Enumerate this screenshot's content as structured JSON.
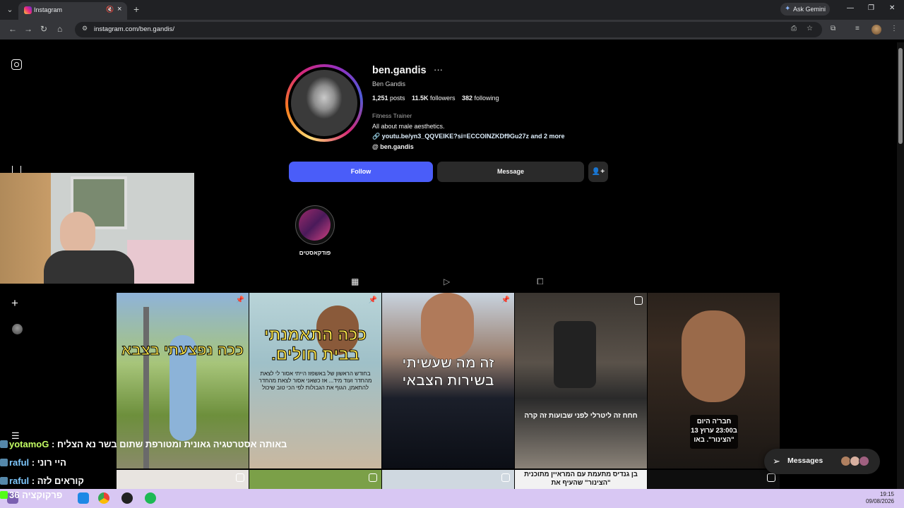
{
  "browser": {
    "tab_title": "Instagram",
    "url": "instagram.com/ben.gandis/",
    "gemini_label": "Ask Gemini"
  },
  "profile": {
    "username": "ben.gandis",
    "full_name": "Ben Gandis",
    "posts_count": "1,251",
    "posts_label": "posts",
    "followers_count": "11.5K",
    "followers_label": "followers",
    "following_count": "382",
    "following_label": "following",
    "category": "Fitness Trainer",
    "bio": "All about male aesthetics.",
    "link": "youtu.be/yn3_QQVEIKE?si=ECCOINZKDf9Gu27z and 2 more",
    "threads_handle": "ben.gandis",
    "follow_label": "Follow",
    "message_label": "Message",
    "highlight_label": "פודקאסטים"
  },
  "posts": [
    {
      "text": "ככה נפצעתי בצבא",
      "sub": ""
    },
    {
      "text": "ככה התאמנתי בבית חולים.",
      "sub": "בחודש הראשון של באשפוז הייתי אסור לי לצאת מהחדר ועוד מיד... אז כשאני אסור לצאת מהחדר להתאמן, הגוף את הגבולות לפי הכי טוב שיכול"
    },
    {
      "text": "זה מה שעשיתי בשירות הצבאי",
      "sub": ""
    },
    {
      "text": "חחח זה ליטרלי לפני שבועות זה קרה",
      "sub": ""
    },
    {
      "text": "חבר'ה היום ב23:00 ערוץ 13 \"הצינור\". באו",
      "sub": ""
    }
  ],
  "bottom_post_text": "בן גנדיס מתעמת עם המראיין מתוכנית \"הצינור\" שהעיף את",
  "chat": [
    {
      "user": "yotamoG",
      "sep": " : ",
      "msg": "באותה אסטרטגיה גאונית ומטורפת שתום בשר נא הצליח"
    },
    {
      "user": "raful",
      "sep": " : ",
      "msg": "היי רוני"
    },
    {
      "user": "raful",
      "sep": " : ",
      "msg": "קוראים לזה"
    },
    {
      "user": "36",
      "sep": " ",
      "msg": "פרקוקציה"
    }
  ],
  "messages_label": "Messages",
  "clock": {
    "time": "19:15",
    "date": "09/08/2026"
  },
  "colors": {
    "follow": "#4a5df9",
    "background": "#000000",
    "taskbar": "#d8c7f3"
  }
}
